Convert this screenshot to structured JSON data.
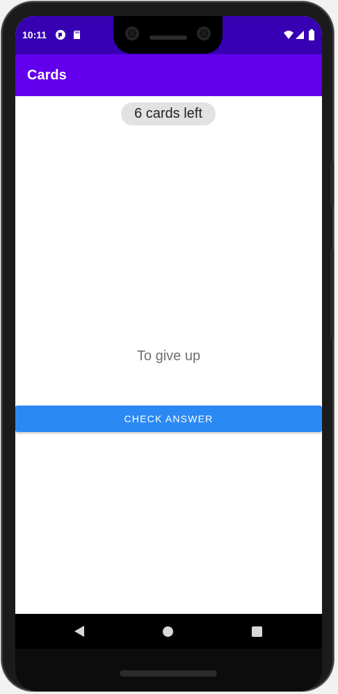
{
  "status_bar": {
    "time": "10:11",
    "left_icons": [
      "app-notification-icon",
      "sd-card-icon"
    ],
    "right_icons": [
      "wifi-icon",
      "cellular-signal-icon",
      "battery-icon"
    ]
  },
  "app_bar": {
    "title": "Cards"
  },
  "main": {
    "cards_left_label": "6 cards left",
    "card_text": "To give up",
    "check_answer_label": "CHECK ANSWER"
  },
  "nav_bar": {
    "icons": [
      "back-icon",
      "home-icon",
      "recents-icon"
    ]
  },
  "colors": {
    "status_bar": "#3700b3",
    "app_bar": "#6200ee",
    "button": "#2b89f4",
    "pill": "#e2e2e2"
  }
}
